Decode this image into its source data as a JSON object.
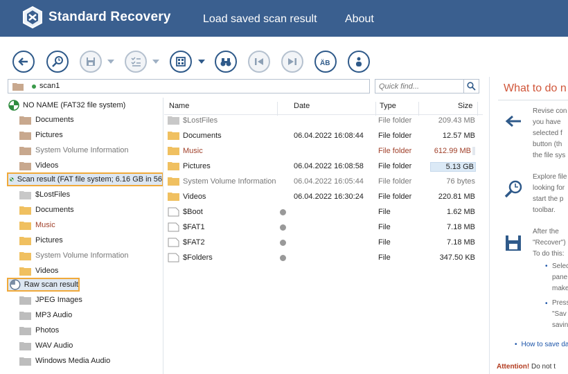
{
  "header": {
    "app_title": "Standard Recovery",
    "nav": [
      "Load saved scan result",
      "About"
    ]
  },
  "toolbar": {
    "buttons": [
      "back-icon",
      "scan-icon",
      "save-icon",
      "checklist-icon",
      "view-mode-icon",
      "find-icon",
      "previous-icon",
      "next-icon",
      "case-icon",
      "info-icon"
    ]
  },
  "path_bar": {
    "text": "scan1"
  },
  "search": {
    "placeholder": "Quick find..."
  },
  "tree": {
    "root": "NO NAME (FAT32 file system)",
    "root_children": [
      "Documents",
      "Pictures",
      "System Volume Information",
      "Videos"
    ],
    "scan_result": "Scan result (FAT file system; 6.16 GB in 56",
    "scan_children": [
      "$LostFiles",
      "Documents",
      "Music",
      "Pictures",
      "System Volume Information",
      "Videos"
    ],
    "raw_result": "Raw scan result",
    "raw_children": [
      "JPEG Images",
      "MP3 Audio",
      "Photos",
      "WAV Audio",
      "Windows Media Audio"
    ]
  },
  "files": {
    "columns": [
      "Name",
      "Date",
      "Type",
      "Size"
    ],
    "rows": [
      {
        "name": "$LostFiles",
        "date": "",
        "type": "File folder",
        "size": "209.43 MB"
      },
      {
        "name": "Documents",
        "date": "06.04.2022 16:08:44",
        "type": "File folder",
        "size": "12.57 MB"
      },
      {
        "name": "Music",
        "date": "",
        "type": "File folder",
        "size": "612.99 MB"
      },
      {
        "name": "Pictures",
        "date": "06.04.2022 16:08:58",
        "type": "File folder",
        "size": "5.13 GB"
      },
      {
        "name": "System Volume Information",
        "date": "06.04.2022 16:05:44",
        "type": "File folder",
        "size": "76 bytes"
      },
      {
        "name": "Videos",
        "date": "06.04.2022 16:30:24",
        "type": "File folder",
        "size": "220.81 MB"
      },
      {
        "name": "$Boot",
        "date": "",
        "type": "File",
        "size": "1.62 MB"
      },
      {
        "name": "$FAT1",
        "date": "",
        "type": "File",
        "size": "7.18 MB"
      },
      {
        "name": "$FAT2",
        "date": "",
        "type": "File",
        "size": "7.18 MB"
      },
      {
        "name": "$Folders",
        "date": "",
        "type": "File",
        "size": "347.50 KB"
      }
    ]
  },
  "right_panel": {
    "title": "What to do n",
    "p1": [
      "Revise con",
      "you have",
      "selected f",
      "button (th",
      "the file sys"
    ],
    "p2": [
      "Explore file",
      "looking for",
      "start the p",
      "toolbar."
    ],
    "p3": [
      "After the",
      "\"Recover\")",
      "To do this:"
    ],
    "bullets": [
      [
        "Selec",
        "pane",
        "make"
      ],
      [
        "Press",
        "\"Sav",
        "savin"
      ]
    ],
    "link": "How to save da",
    "attention_label": "Attention!",
    "attention_text": " Do not t"
  }
}
